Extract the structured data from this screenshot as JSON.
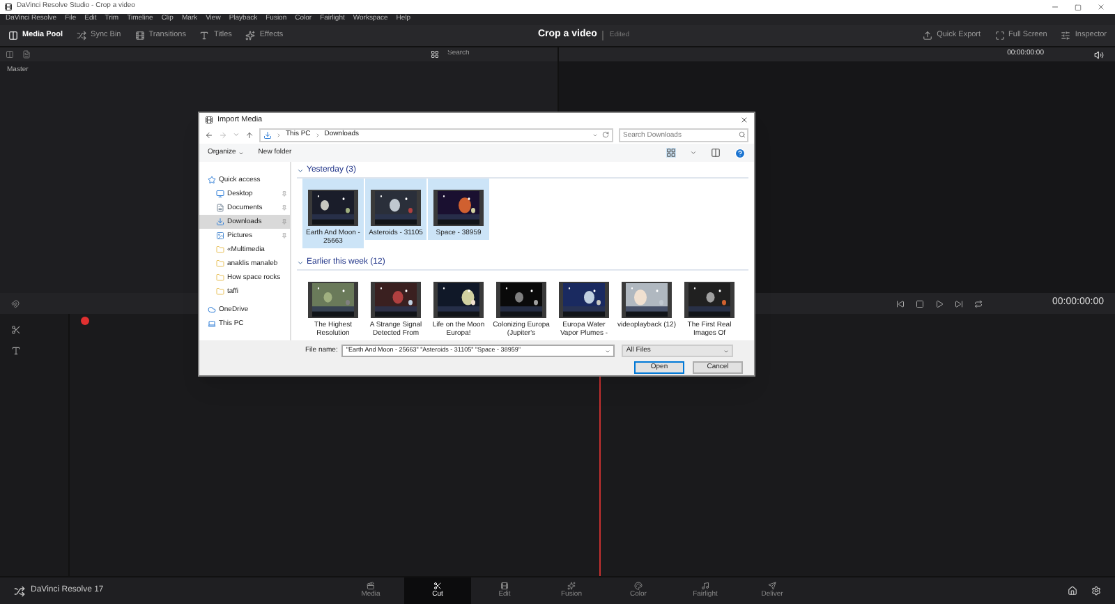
{
  "window": {
    "title": "DaVinci Resolve Studio - Crop a video"
  },
  "menu": [
    "DaVinci Resolve",
    "File",
    "Edit",
    "Trim",
    "Timeline",
    "Clip",
    "Mark",
    "View",
    "Playback",
    "Fusion",
    "Color",
    "Fairlight",
    "Workspace",
    "Help"
  ],
  "toolbar": {
    "left": [
      {
        "label": "Media Pool",
        "selected": true
      },
      {
        "label": "Sync Bin",
        "selected": false
      },
      {
        "label": "Transitions",
        "selected": false
      },
      {
        "label": "Titles",
        "selected": false
      },
      {
        "label": "Effects",
        "selected": false
      }
    ],
    "project": "Crop a video",
    "status": "Edited",
    "right": [
      "Quick Export",
      "Full Screen",
      "Inspector"
    ]
  },
  "media_pool": {
    "search_placeholder": "Search",
    "bin": "Master"
  },
  "viewer": {
    "timecode": "00:00:00:00"
  },
  "transport": {
    "timecode": "00:00:00:00"
  },
  "dialog": {
    "title": "Import Media",
    "path": [
      "This PC",
      "Downloads"
    ],
    "search_placeholder": "Search Downloads",
    "commands": [
      "Organize",
      "New folder"
    ],
    "sidebar": [
      {
        "label": "Quick access",
        "selected": false,
        "children": [
          {
            "label": "Desktop",
            "pinned": true,
            "selected": false
          },
          {
            "label": "Documents",
            "pinned": true,
            "selected": false
          },
          {
            "label": "Downloads",
            "pinned": true,
            "selected": true
          },
          {
            "label": "Pictures",
            "pinned": true,
            "selected": false
          },
          {
            "label": "«Multimedia",
            "pinned": false,
            "selected": false
          },
          {
            "label": "anaklis manaleb",
            "pinned": false,
            "selected": false
          },
          {
            "label": "How space rocks",
            "pinned": false,
            "selected": false
          },
          {
            "label": "taffi",
            "pinned": false,
            "selected": false
          }
        ]
      },
      {
        "label": "OneDrive",
        "selected": false
      },
      {
        "label": "This PC",
        "selected": false
      }
    ],
    "groups": [
      {
        "title": "Yesterday (3)",
        "expanded": true,
        "files": [
          {
            "name": "Earth And Moon - 25663",
            "selected": true
          },
          {
            "name": "Asteroids - 31105",
            "selected": true
          },
          {
            "name": "Space - 38959",
            "selected": true
          }
        ]
      },
      {
        "title": "Earlier this week (12)",
        "expanded": true,
        "files": [
          {
            "name": "The Highest Resolution",
            "selected": false
          },
          {
            "name": "A Strange Signal Detected From",
            "selected": false
          },
          {
            "name": "Life on the Moon Europa!",
            "selected": false
          },
          {
            "name": "Colonizing Europa (Jupiter's",
            "selected": false
          },
          {
            "name": "Europa Water Vapor Plumes -",
            "selected": false
          },
          {
            "name": "videoplayback (12)",
            "selected": false
          },
          {
            "name": "The First Real Images Of",
            "selected": false
          }
        ]
      }
    ],
    "file_name_label": "File name:",
    "file_name": "\"Earth And Moon - 25663\" \"Asteroids - 31105\" \"Space - 38959\"",
    "filter": "All Files",
    "buttons": [
      {
        "label": "Open",
        "default": true
      },
      {
        "label": "Cancel",
        "default": false
      }
    ]
  },
  "app_name": "DaVinci Resolve 17",
  "pages": [
    {
      "label": "Media",
      "selected": false
    },
    {
      "label": "Cut",
      "selected": true
    },
    {
      "label": "Edit",
      "selected": false
    },
    {
      "label": "Fusion",
      "selected": false
    },
    {
      "label": "Color",
      "selected": false
    },
    {
      "label": "Fairlight",
      "selected": false
    },
    {
      "label": "Deliver",
      "selected": false
    }
  ]
}
